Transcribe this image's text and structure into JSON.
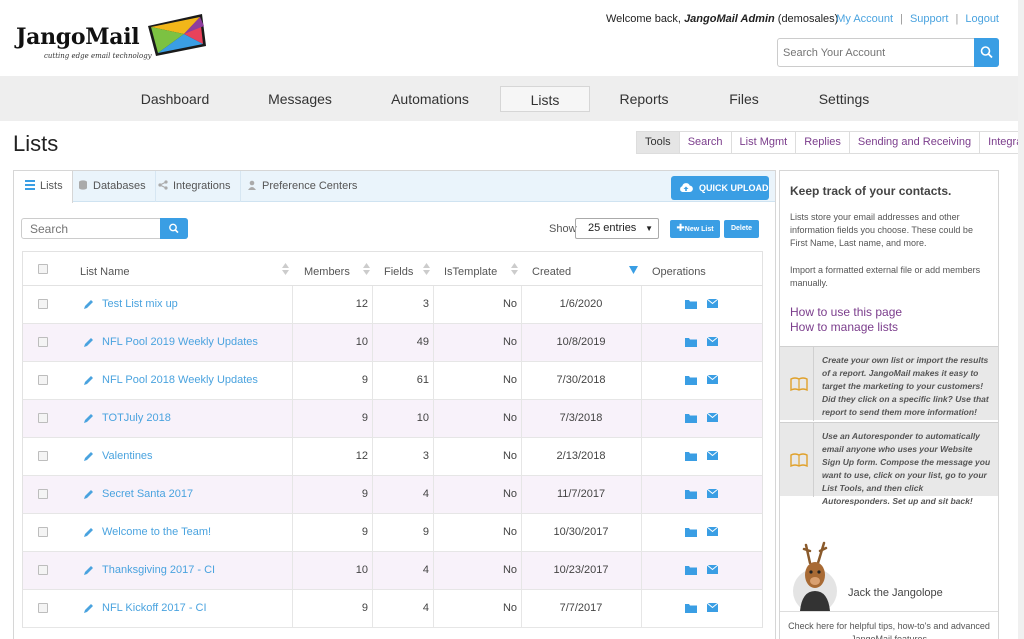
{
  "header": {
    "logo_text": "JangoMail",
    "logo_tagline": "cutting edge email technology",
    "welcome_prefix": "Welcome back, ",
    "welcome_user": "JangoMail Admin",
    "welcome_suffix": " (demosales)",
    "links": [
      "My Account",
      "Support",
      "Logout"
    ],
    "search_placeholder": "Search Your Account"
  },
  "nav": {
    "items": [
      "Dashboard",
      "Messages",
      "Automations",
      "Lists",
      "Reports",
      "Files",
      "Settings"
    ],
    "active": "Lists"
  },
  "page": {
    "title": "Lists",
    "tools": [
      "Tools",
      "Search",
      "List Mgmt",
      "Replies",
      "Sending and Receiving",
      "Integrate"
    ]
  },
  "tabs": {
    "items": [
      "Lists",
      "Databases",
      "Integrations",
      "Preference Centers"
    ],
    "active": "Lists",
    "quick_upload": "QUICK UPLOAD"
  },
  "controls": {
    "search_placeholder": "Search",
    "show_label": "Show",
    "entries_value": "25 entries",
    "new_list": "New List",
    "delete": "Delete"
  },
  "table": {
    "columns": [
      "List Name",
      "Members",
      "Fields",
      "IsTemplate",
      "Created",
      "Operations"
    ],
    "rows": [
      {
        "name": "Test List mix up",
        "members": "12",
        "fields": "3",
        "template": "No",
        "created": "1/6/2020"
      },
      {
        "name": "NFL Pool 2019 Weekly Updates",
        "members": "10",
        "fields": "49",
        "template": "No",
        "created": "10/8/2019"
      },
      {
        "name": "NFL Pool 2018 Weekly Updates",
        "members": "9",
        "fields": "61",
        "template": "No",
        "created": "7/30/2018"
      },
      {
        "name": "TOTJuly 2018",
        "members": "9",
        "fields": "10",
        "template": "No",
        "created": "7/3/2018"
      },
      {
        "name": "Valentines",
        "members": "12",
        "fields": "3",
        "template": "No",
        "created": "2/13/2018"
      },
      {
        "name": "Secret Santa 2017",
        "members": "9",
        "fields": "4",
        "template": "No",
        "created": "11/7/2017"
      },
      {
        "name": "Welcome to the Team!",
        "members": "9",
        "fields": "9",
        "template": "No",
        "created": "10/30/2017"
      },
      {
        "name": "Thanksgiving 2017 - CI",
        "members": "10",
        "fields": "4",
        "template": "No",
        "created": "10/23/2017"
      },
      {
        "name": "NFL Kickoff 2017 - CI",
        "members": "9",
        "fields": "4",
        "template": "No",
        "created": "7/7/2017"
      }
    ]
  },
  "sidebar": {
    "heading": "Keep track of your contacts.",
    "para1": "Lists store your email addresses and other information fields you choose. These could be First Name, Last name, and more.",
    "para2": "Import a formatted external file or add members manually.",
    "link1": "How to use this page",
    "link2": "How to manage lists",
    "tip1": "Create your own list or import the results of a report. JangoMail makes it easy to target the marketing to your customers! Did they click on a specific link? Use that report to send them more information!",
    "tip2": "Use an Autoresponder to automatically email anyone who uses your Website Sign Up form. Compose the message you want to use, click on your list, go to your List Tools, and then click Autoresponders. Set up and sit back!",
    "mascot_name": "Jack the Jangolope",
    "check_here": "Check here for helpful tips, how-to's and advanced JangoMail features"
  },
  "colors": {
    "accent": "#3a9ee4",
    "link": "#4aa3df",
    "purple": "#7b3d8c"
  }
}
